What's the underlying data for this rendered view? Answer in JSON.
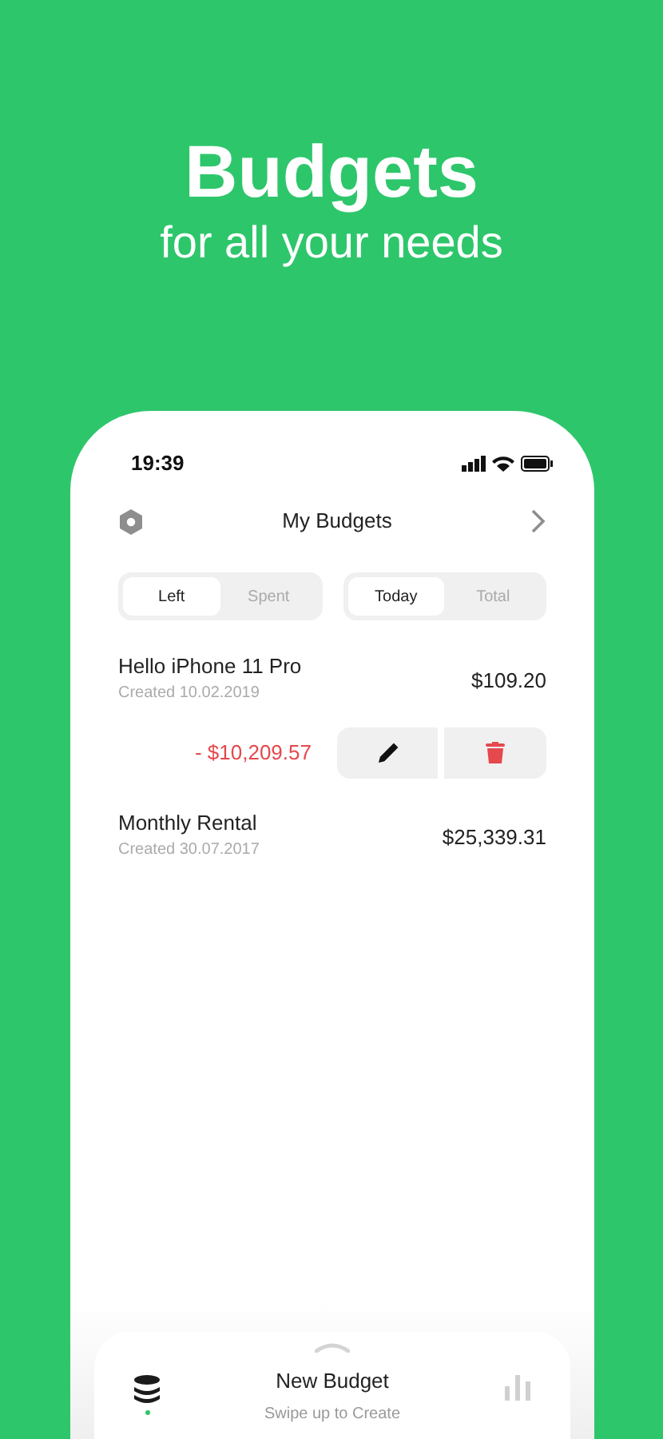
{
  "hero": {
    "title": "Budgets",
    "subtitle": "for all your needs"
  },
  "status_bar": {
    "time": "19:39"
  },
  "nav": {
    "title": "My Budgets"
  },
  "segments": [
    {
      "options": [
        {
          "label": "Left",
          "selected": true
        },
        {
          "label": "Spent",
          "selected": false
        }
      ]
    },
    {
      "options": [
        {
          "label": "Today",
          "selected": true
        },
        {
          "label": "Total",
          "selected": false
        }
      ]
    }
  ],
  "budgets": [
    {
      "name": "Hello iPhone 11 Pro",
      "created": "Created 10.02.2019",
      "amount": "$109.20",
      "swiped": true,
      "difference": "- $10,209.57"
    },
    {
      "name": "Monthly Rental",
      "created": "Created 30.07.2017",
      "amount": "$25,339.31",
      "swiped": false
    }
  ],
  "bottom_bar": {
    "title": "New Budget",
    "hint": "Swipe up to Create",
    "tabs": [
      {
        "kind": "budgets",
        "selected": true
      },
      {
        "kind": "stats",
        "selected": false
      }
    ]
  }
}
